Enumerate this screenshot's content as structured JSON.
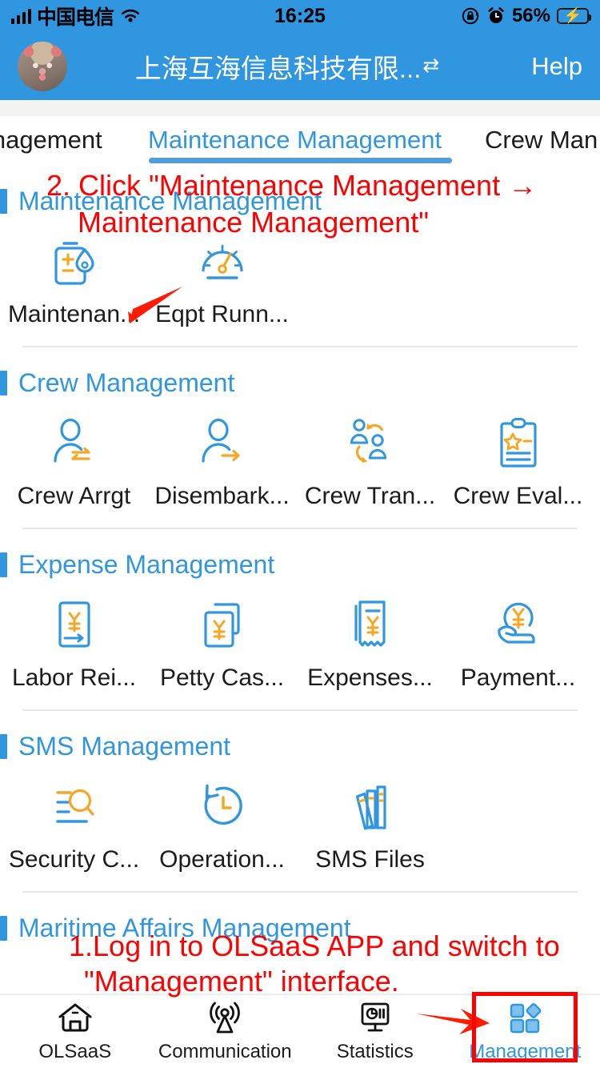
{
  "statusbar": {
    "carrier": "中国电信",
    "signal_icon": "signal-bars-icon",
    "wifi_icon": "wifi-icon",
    "time": "16:25",
    "rotation_lock_icon": "rotation-lock-icon",
    "alarm_icon": "alarm-clock-icon",
    "battery_percent": "56%",
    "battery_icon": "battery-charging-icon"
  },
  "header": {
    "avatar": "user-avatar",
    "company": "上海互海信息科技有限...",
    "switch_icon": "switch-company-icon",
    "help_label": "Help",
    "bg_color": "#3196e0"
  },
  "tabs": {
    "items": [
      {
        "label": "...nagement",
        "active": false
      },
      {
        "label": "Maintenance Management",
        "active": true
      },
      {
        "label": "Crew Man...",
        "active": false
      }
    ],
    "active_index": 1,
    "accent_color": "#3196e0"
  },
  "sections": [
    {
      "title": "Maintenance Management",
      "items": [
        {
          "label": "Maintenan...",
          "icon": "oil-bottle-icon"
        },
        {
          "label": "Eqpt Runn...",
          "icon": "gauge-icon"
        }
      ]
    },
    {
      "title": "Crew Management",
      "items": [
        {
          "label": "Crew Arrgt",
          "icon": "person-exchange-icon"
        },
        {
          "label": "Disembark...",
          "icon": "person-arrow-icon"
        },
        {
          "label": "Crew Tran...",
          "icon": "people-transfer-icon"
        },
        {
          "label": "Crew Eval...",
          "icon": "clipboard-star-icon"
        }
      ]
    },
    {
      "title": "Expense Management",
      "items": [
        {
          "label": "Labor Rei...",
          "icon": "yen-card-arrow-icon"
        },
        {
          "label": "Petty Cas...",
          "icon": "yen-documents-icon"
        },
        {
          "label": "Expenses...",
          "icon": "yen-receipt-icon"
        },
        {
          "label": "Payment...",
          "icon": "yen-hand-icon"
        }
      ]
    },
    {
      "title": "SMS Management",
      "items": [
        {
          "label": "Security C...",
          "icon": "search-list-icon"
        },
        {
          "label": "Operation...",
          "icon": "clock-history-icon"
        },
        {
          "label": "SMS Files",
          "icon": "books-icon"
        }
      ]
    },
    {
      "title": "Maritime Affairs Management",
      "items": []
    }
  ],
  "bottom_nav": {
    "items": [
      {
        "label": "OLSaaS",
        "icon": "home-icon",
        "active": false
      },
      {
        "label": "Communication",
        "icon": "broadcast-icon",
        "active": false
      },
      {
        "label": "Statistics",
        "icon": "monitor-chart-icon",
        "active": false
      },
      {
        "label": "Management",
        "icon": "grid-shapes-icon",
        "active": true
      }
    ],
    "active_color": "#3196e0"
  },
  "annotations": {
    "color": "#ff0000",
    "step2_line1": "2. Click \"Maintenance Management →",
    "step2_line2": "Maintenance Management\"",
    "step1_line1": "1.Log in to OLSaaS APP and switch to",
    "step1_line2": "\"Management\" interface.",
    "arrow_to_maintenance": "red-arrow-icon",
    "arrow_to_management_tab": "red-arrow-icon",
    "highlight_box": "red-highlight-box"
  }
}
